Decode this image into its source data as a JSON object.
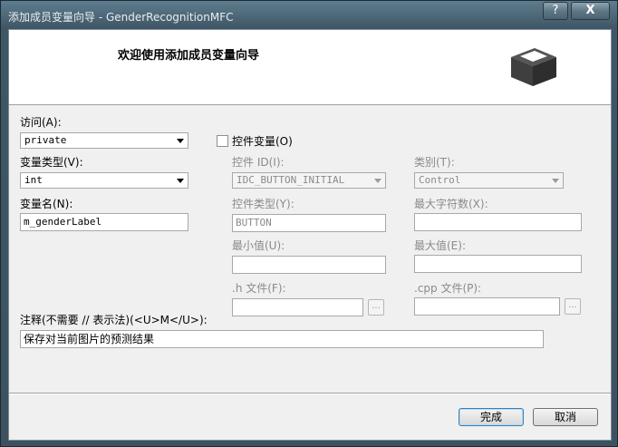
{
  "window": {
    "title": "添加成员变量向导 - GenderRecognitionMFC",
    "help_label": "?",
    "close_label": "X"
  },
  "header": {
    "title": "欢迎使用添加成员变量向导",
    "icon": "box-icon"
  },
  "form": {
    "access": {
      "label": "访问(A):",
      "value": "private"
    },
    "var_type": {
      "label": "变量类型(V):",
      "value": "int"
    },
    "var_name": {
      "label": "变量名(N):",
      "value": "m_genderLabel"
    },
    "control_variable": {
      "label": "控件变量(O)",
      "checked": false
    },
    "control_id": {
      "label": "控件 ID(I):",
      "value": "IDC_BUTTON_INITIAL"
    },
    "category": {
      "label": "类别(T):",
      "value": "Control"
    },
    "control_type": {
      "label": "控件类型(Y):",
      "value": "BUTTON"
    },
    "max_chars": {
      "label": "最大字符数(X):",
      "value": ""
    },
    "min_value": {
      "label": "最小值(U):",
      "value": ""
    },
    "max_value": {
      "label": "最大值(E):",
      "value": ""
    },
    "h_file": {
      "label": ".h 文件(F):",
      "value": "",
      "browse_label": "..."
    },
    "cpp_file": {
      "label": ".cpp 文件(P):",
      "value": "",
      "browse_label": "..."
    },
    "comment": {
      "label": "注释(不需要 // 表示法)(<U>M</U>):",
      "value": "保存对当前图片的预测结果"
    }
  },
  "buttons": {
    "finish": "完成",
    "cancel": "取消"
  }
}
